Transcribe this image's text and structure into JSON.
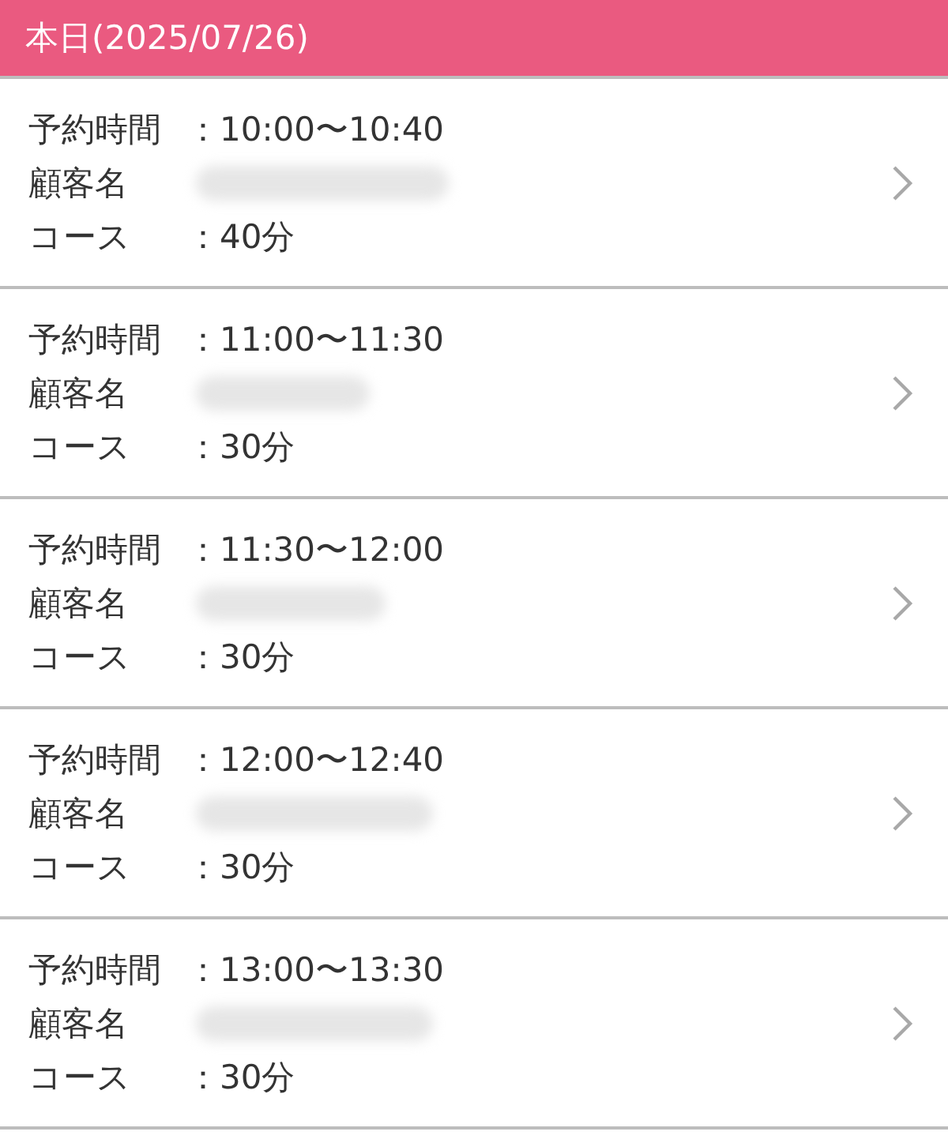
{
  "header": {
    "title": "本日(2025/07/26)"
  },
  "reservations": [
    {
      "time_label": "予約時間",
      "time": "：10:00〜10:40",
      "customer_label": "顧客名",
      "course_label": "コース",
      "course": "：40分"
    },
    {
      "time_label": "予約時間",
      "time": "：11:00〜11:30",
      "customer_label": "顧客名",
      "course_label": "コース",
      "course": "：30分"
    },
    {
      "time_label": "予約時間",
      "time": "：11:30〜12:00",
      "customer_label": "顧客名",
      "course_label": "コース",
      "course": "：30分"
    },
    {
      "time_label": "予約時間",
      "time": "：12:00〜12:40",
      "customer_label": "顧客名",
      "course_label": "コース",
      "course": "：30分"
    },
    {
      "time_label": "予約時間",
      "time": "：13:00〜13:30",
      "customer_label": "顧客名",
      "course_label": "コース",
      "course": "：30分"
    }
  ]
}
